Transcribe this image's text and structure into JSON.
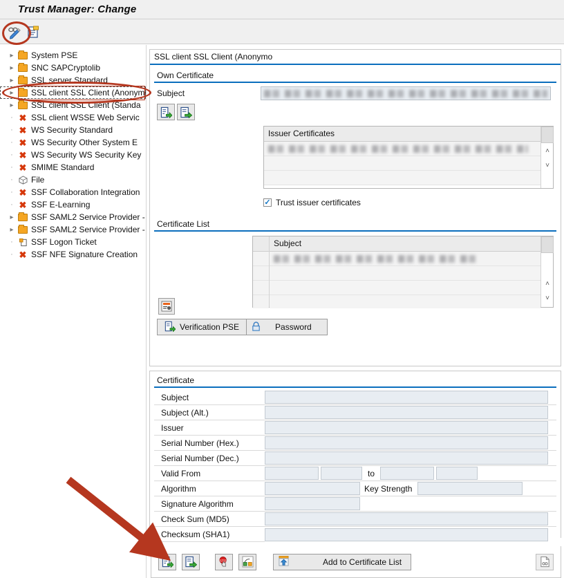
{
  "window": {
    "title": "Trust Manager: Change"
  },
  "toolbar": {
    "items": [
      {
        "name": "display-change-icon",
        "tooltip": "Display <-> Change"
      },
      {
        "name": "other-file-icon",
        "tooltip": "Other File"
      }
    ]
  },
  "tree": {
    "items": [
      {
        "label": "System PSE",
        "icon": "folder-icon",
        "expandable": true,
        "selected": false
      },
      {
        "label": "SNC SAPCryptolib",
        "icon": "folder-icon",
        "expandable": true,
        "selected": false
      },
      {
        "label": "SSL server Standard",
        "icon": "folder-icon",
        "expandable": true,
        "selected": false
      },
      {
        "label": "SSL client SSL Client (Anonymo",
        "icon": "folder-icon",
        "expandable": true,
        "selected": true
      },
      {
        "label": "SSL client SSL Client (Standa",
        "icon": "folder-icon",
        "expandable": true,
        "selected": false
      },
      {
        "label": "SSL client WSSE Web Servic",
        "icon": "x-mark-icon",
        "expandable": false,
        "selected": false
      },
      {
        "label": "WS Security Standard",
        "icon": "x-mark-icon",
        "expandable": false,
        "selected": false
      },
      {
        "label": "WS Security Other System E",
        "icon": "x-mark-icon",
        "expandable": false,
        "selected": false
      },
      {
        "label": "WS Security WS Security Key",
        "icon": "x-mark-icon",
        "expandable": false,
        "selected": false
      },
      {
        "label": "SMIME Standard",
        "icon": "x-mark-icon",
        "expandable": false,
        "selected": false
      },
      {
        "label": "File",
        "icon": "package-icon",
        "expandable": false,
        "selected": false
      },
      {
        "label": "SSF Collaboration Integration",
        "icon": "x-mark-icon",
        "expandable": false,
        "selected": false
      },
      {
        "label": "SSF E-Learning",
        "icon": "x-mark-icon",
        "expandable": false,
        "selected": false
      },
      {
        "label": "SSF SAML2 Service Provider -",
        "icon": "folder-icon",
        "expandable": true,
        "selected": false
      },
      {
        "label": "SSF SAML2 Service Provider -",
        "icon": "folder-icon",
        "expandable": true,
        "selected": false
      },
      {
        "label": "SSF Logon Ticket",
        "icon": "ticket-icon",
        "expandable": false,
        "selected": false
      },
      {
        "label": "SSF NFE Signature Creation",
        "icon": "x-mark-icon",
        "expandable": false,
        "selected": false
      }
    ]
  },
  "detail": {
    "panel_title": "SSL client SSL Client (Anonymo",
    "own_certificate": {
      "group_label": "Own Certificate",
      "subject_label": "Subject",
      "subject_value": "",
      "toolbar": [
        {
          "name": "import-certificate-icon"
        },
        {
          "name": "export-certificate-icon"
        }
      ],
      "issuer_certificates": {
        "header": "Issuer Certificates",
        "rows": [
          "",
          "",
          ""
        ],
        "scroll_up": "˄",
        "scroll_down": "˅"
      },
      "trust_issuer": {
        "label": "Trust issuer certificates",
        "checked": true,
        "check_glyph": "✓"
      }
    },
    "certificate_list": {
      "group_label": "Certificate List",
      "column_header": "Subject",
      "rows": [
        "",
        "",
        "",
        ""
      ],
      "scroll_up": "˄",
      "scroll_down": "˅",
      "action_icon": "show-certificate-list-icon"
    },
    "pse_buttons": {
      "verification_pse": "Verification PSE",
      "verification_pse_icon": "import-pse-icon",
      "password": "Password",
      "password_icon": "lock-icon"
    },
    "certificate": {
      "group_label": "Certificate",
      "fields": [
        {
          "label": "Subject",
          "value": "",
          "kind": "wide"
        },
        {
          "label": "Subject (Alt.)",
          "value": "",
          "kind": "wide"
        },
        {
          "label": "Issuer",
          "value": "",
          "kind": "wide"
        },
        {
          "label": "Serial Number (Hex.)",
          "value": "",
          "kind": "wide"
        },
        {
          "label": "Serial Number (Dec.)",
          "value": "",
          "kind": "wide"
        }
      ],
      "valid_from": {
        "label": "Valid From",
        "date_value": "",
        "time_value": "",
        "to_label": "to",
        "to_date_value": "",
        "to_time_value": ""
      },
      "algorithm": {
        "label": "Algorithm",
        "value": "",
        "key_strength_label": "Key Strength",
        "key_strength_value": ""
      },
      "signature_algorithm": {
        "label": "Signature Algorithm",
        "value": ""
      },
      "checksum_md5": {
        "label": "Check Sum (MD5)",
        "value": ""
      },
      "checksum_sha1": {
        "label": "Checksum (SHA1)",
        "value": ""
      }
    },
    "bottom_toolbar": {
      "import_icon": "import-certificate-icon",
      "export_icon": "export-certificate-icon",
      "revoke_icon": "revocation-list-icon",
      "path_icon": "certificate-path-icon",
      "add_button_label": "Add to Certificate List",
      "add_button_icon": "add-to-list-icon",
      "info_icon": "certificate-info-icon"
    }
  },
  "annotations": {
    "accent_color": "#b5371f",
    "ellipse_toolbar": "highlight-display-change-button",
    "ellipse_tree": "highlight-ssl-client-anonymous-node",
    "arrow": "pointer-to-import-certificate-button"
  }
}
